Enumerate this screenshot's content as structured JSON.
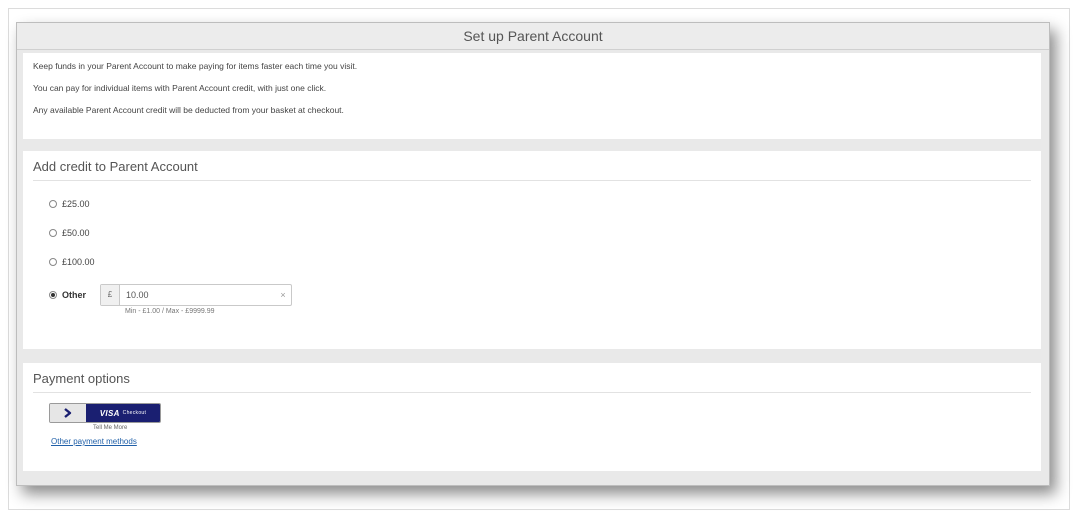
{
  "panel": {
    "title": "Set up Parent Account"
  },
  "intro": {
    "lines": [
      "Keep funds in your Parent Account to make paying for items faster each time you visit.",
      "You can pay for individual items with Parent Account credit, with just one click.",
      "Any available Parent Account credit will be deducted from your basket at checkout."
    ]
  },
  "credit": {
    "heading": "Add credit to Parent Account",
    "options": [
      {
        "label": "£25.00",
        "selected": false
      },
      {
        "label": "£50.00",
        "selected": false
      },
      {
        "label": "£100.00",
        "selected": false
      }
    ],
    "other": {
      "label": "Other",
      "selected": true,
      "currency_symbol": "£",
      "value": "10.00",
      "clear_symbol": "×",
      "hint": "Min - £1.00 / Max - £9999.99"
    }
  },
  "payment": {
    "heading": "Payment options",
    "visa_label": "VISA",
    "visa_checkout_word": "Checkout",
    "tell_more": "Tell Me More",
    "other_methods": "Other payment methods"
  },
  "colors": {
    "visa_blue": "#1a1f71",
    "link_blue": "#1f5fa8",
    "panel_bg": "#e9e9e9"
  }
}
